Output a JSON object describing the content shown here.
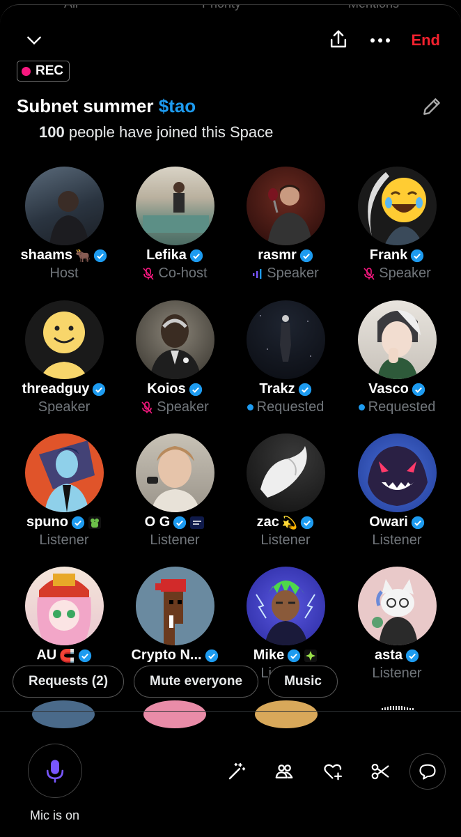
{
  "background_tabs": [
    "All",
    "Priority",
    "Mentions"
  ],
  "header": {
    "end_label": "End",
    "rec_label": "REC"
  },
  "space": {
    "title_prefix": "Subnet summer ",
    "title_highlight": "$tao",
    "joined_count": "100",
    "joined_text": " people have joined this Space"
  },
  "participants": [
    {
      "name": "shaams",
      "emoji": "🐂",
      "verified": true,
      "role": "Host",
      "role_icon": "none"
    },
    {
      "name": "Lefika",
      "verified": true,
      "role": "Co-host",
      "role_icon": "mic-muted-icon"
    },
    {
      "name": "rasmr",
      "verified": true,
      "role": "Speaker",
      "role_icon": "audio-bars-icon"
    },
    {
      "name": "Frank",
      "verified": true,
      "role": "Speaker",
      "role_icon": "mic-muted-icon"
    },
    {
      "name": "threadguy",
      "verified": true,
      "role": "Speaker",
      "role_icon": "none"
    },
    {
      "name": "Koios",
      "verified": true,
      "role": "Speaker",
      "role_icon": "mic-muted-icon"
    },
    {
      "name": "Trakz",
      "verified": true,
      "role": "Requested",
      "role_icon": "blue-dot-icon"
    },
    {
      "name": "Vasco",
      "verified": true,
      "role": "Requested",
      "role_icon": "blue-dot-icon"
    },
    {
      "name": "spuno",
      "verified": true,
      "affiliate": "frog-badge-icon",
      "role": "Listener",
      "role_icon": "none"
    },
    {
      "name": "O G",
      "verified": true,
      "affiliate": "travel-swap-badge-icon",
      "role": "Listener",
      "role_icon": "none"
    },
    {
      "name": "zac",
      "emoji": "💫",
      "verified": true,
      "role": "Listener",
      "role_icon": "none"
    },
    {
      "name": "Owari",
      "verified": true,
      "role": "Listener",
      "role_icon": "none"
    },
    {
      "name": "AU",
      "emoji": "🧲",
      "verified": true,
      "role": "",
      "role_icon": "none"
    },
    {
      "name": "Crypto N...",
      "verified": true,
      "role": "",
      "role_icon": "none"
    },
    {
      "name": "Mike",
      "verified": true,
      "affiliate": "sparkle-badge-icon",
      "role": "Listener",
      "role_icon": "none"
    },
    {
      "name": "asta",
      "verified": true,
      "role": "Listener",
      "role_icon": "none"
    }
  ],
  "actions": {
    "requests_label": "Requests (2)",
    "mute_label": "Mute everyone",
    "music_label": "Music"
  },
  "bottom": {
    "mic_label": "Mic is on"
  },
  "colors": {
    "accent": "#1d9bf0",
    "end": "#f4212e",
    "rec": "#f91880",
    "mic": "#7856ff",
    "muted": "#f91880",
    "secondary_text": "#71767b"
  }
}
